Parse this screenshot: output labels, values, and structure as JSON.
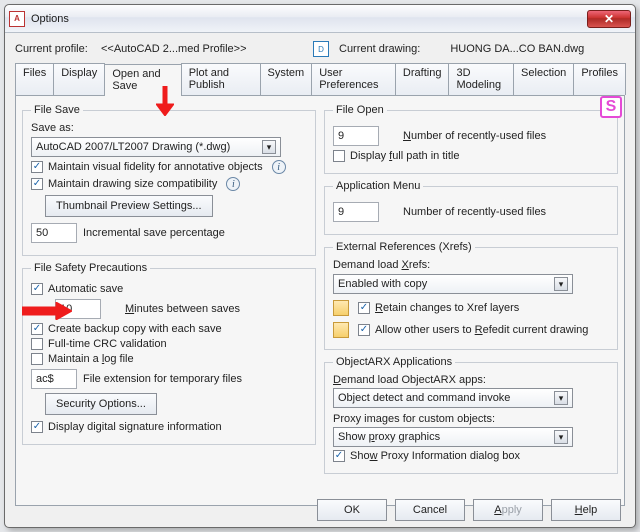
{
  "window": {
    "title": "Options"
  },
  "profile": {
    "label": "Current profile:",
    "value": "<<AutoCAD 2...med Profile>>",
    "drawing_label": "Current drawing:",
    "drawing_value": "HUONG DA...CO BAN.dwg"
  },
  "tabs": [
    "Files",
    "Display",
    "Open and Save",
    "Plot and Publish",
    "System",
    "User Preferences",
    "Drafting",
    "3D Modeling",
    "Selection",
    "Profiles"
  ],
  "active_tab": "Open and Save",
  "file_save": {
    "legend": "File Save",
    "save_as_label": "Save as:",
    "save_as_value": "AutoCAD 2007/LT2007 Drawing (*.dwg)",
    "visual_fidelity": "Maintain visual fidelity for annotative objects",
    "drawing_size": "Maintain drawing size compatibility",
    "thumbnail_btn": "Thumbnail Preview Settings...",
    "inc_save_value": "50",
    "inc_save_label": "Incremental save percentage"
  },
  "safety": {
    "legend": "File Safety Precautions",
    "autosave": "Automatic save",
    "minutes_value": "10",
    "minutes_label": "Minutes between saves",
    "backup": "Create backup copy with each save",
    "crc": "Full-time CRC validation",
    "logfile": "Maintain a log file",
    "ext_value": "ac$",
    "ext_label": "File extension for temporary files",
    "security_btn": "Security Options...",
    "sig": "Display digital signature information"
  },
  "file_open": {
    "legend": "File Open",
    "recent_value": "9",
    "recent_label_pre": "N",
    "recent_label_rest": "umber of recently-used files",
    "full_path": "Display full path in title"
  },
  "app_menu": {
    "legend": "Application Menu",
    "recent_value": "9",
    "recent_label": "Number of recently-used files"
  },
  "xrefs": {
    "legend": "External References (Xrefs)",
    "demand_label": "Demand load Xrefs:",
    "demand_value": "Enabled with copy",
    "retain": "Retain changes to Xref layers",
    "allow": "Allow other users to Refedit current drawing"
  },
  "arx": {
    "legend": "ObjectARX Applications",
    "demand_label": "Demand load ObjectARX apps:",
    "demand_value": "Object detect and command invoke",
    "proxy_label": "Proxy images for custom objects:",
    "proxy_value": "Show proxy graphics",
    "show_proxy": "Show Proxy Information dialog box"
  },
  "footer": {
    "ok": "OK",
    "cancel": "Cancel",
    "apply": "Apply",
    "help": "Help"
  }
}
